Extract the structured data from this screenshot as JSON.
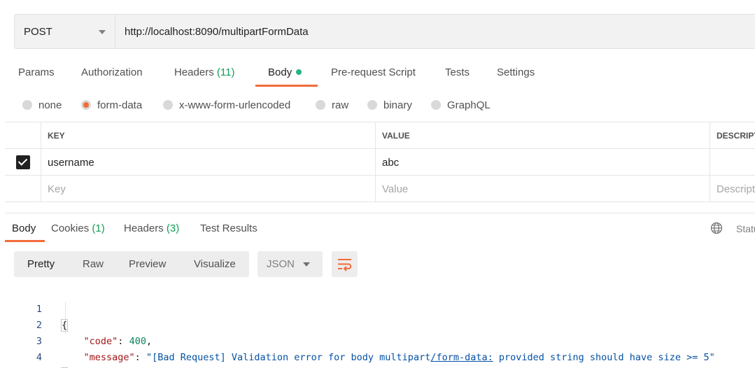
{
  "request": {
    "method": "POST",
    "url": "http://localhost:8090/multipartFormData"
  },
  "request_tabs": [
    {
      "label": "Params"
    },
    {
      "label": "Authorization"
    },
    {
      "label": "Headers",
      "count": "(11)"
    },
    {
      "label": "Body",
      "active": true
    },
    {
      "label": "Pre-request Script"
    },
    {
      "label": "Tests"
    },
    {
      "label": "Settings"
    }
  ],
  "body_types": [
    {
      "label": "none"
    },
    {
      "label": "form-data",
      "selected": true
    },
    {
      "label": "x-www-form-urlencoded"
    },
    {
      "label": "raw"
    },
    {
      "label": "binary"
    },
    {
      "label": "GraphQL"
    }
  ],
  "form_table": {
    "headers": {
      "key": "KEY",
      "value": "VALUE",
      "description": "DESCRIPTION"
    },
    "rows": [
      {
        "checked": true,
        "key": "username",
        "value": "abc",
        "description": ""
      }
    ],
    "placeholders": {
      "key": "Key",
      "value": "Value",
      "description": "Description"
    }
  },
  "response_tabs": [
    {
      "label": "Body",
      "active": true
    },
    {
      "label": "Cookies",
      "count": "(1)"
    },
    {
      "label": "Headers",
      "count": "(3)"
    },
    {
      "label": "Test Results"
    }
  ],
  "response_status_label": "Status",
  "view_modes": [
    "Pretty",
    "Raw",
    "Preview",
    "Visualize"
  ],
  "format": "JSON",
  "response_body": {
    "line_numbers": [
      "1",
      "2",
      "3",
      "4"
    ],
    "open_brace": "{",
    "close_brace": "}",
    "fields": [
      {
        "key": "\"code\"",
        "value": "400",
        "type": "number",
        "trailing": ","
      },
      {
        "key": "\"message\"",
        "value_before": "\"[Bad Request] Validation error for body multipart",
        "value_link": "/form-data:",
        "value_after": " provided string should have size >= 5\"",
        "type": "string",
        "trailing": ""
      }
    ]
  },
  "colors": {
    "accent": "#f26b3a",
    "count_green": "#0f9d58",
    "body_dot": "#26b47f"
  }
}
